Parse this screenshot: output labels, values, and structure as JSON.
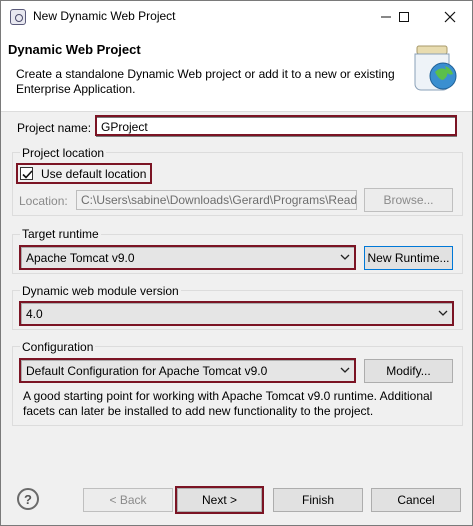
{
  "window": {
    "title": "New Dynamic Web Project",
    "minimize_icon": "minimize-icon",
    "maximize_icon": "maximize-icon",
    "close_icon": "close-icon"
  },
  "header": {
    "title": "Dynamic Web Project",
    "description": "Create a standalone Dynamic Web project or add it to a new or existing Enterprise Application."
  },
  "project_name": {
    "label": "Project name:",
    "value": "GProject"
  },
  "project_location": {
    "group_title": "Project location",
    "use_default_label": "Use default location",
    "use_default_checked": true,
    "location_label": "Location:",
    "location_value": "C:\\Users\\sabine\\Downloads\\Gerard\\Programs\\Read",
    "browse_label": "Browse..."
  },
  "target_runtime": {
    "group_title": "Target runtime",
    "selected": "Apache Tomcat v9.0",
    "new_runtime_label": "New Runtime..."
  },
  "module_version": {
    "group_title": "Dynamic web module version",
    "selected": "4.0"
  },
  "configuration": {
    "group_title": "Configuration",
    "selected": "Default Configuration for Apache Tomcat v9.0",
    "modify_label": "Modify...",
    "info": "A good starting point for working with Apache Tomcat v9.0 runtime. Additional facets can later be installed to add new functionality to the project."
  },
  "footer": {
    "help_glyph": "?",
    "back_label": "< Back",
    "next_label": "Next >",
    "finish_label": "Finish",
    "cancel_label": "Cancel"
  },
  "colors": {
    "highlight": "#7b1424",
    "accent": "#0078d7"
  }
}
